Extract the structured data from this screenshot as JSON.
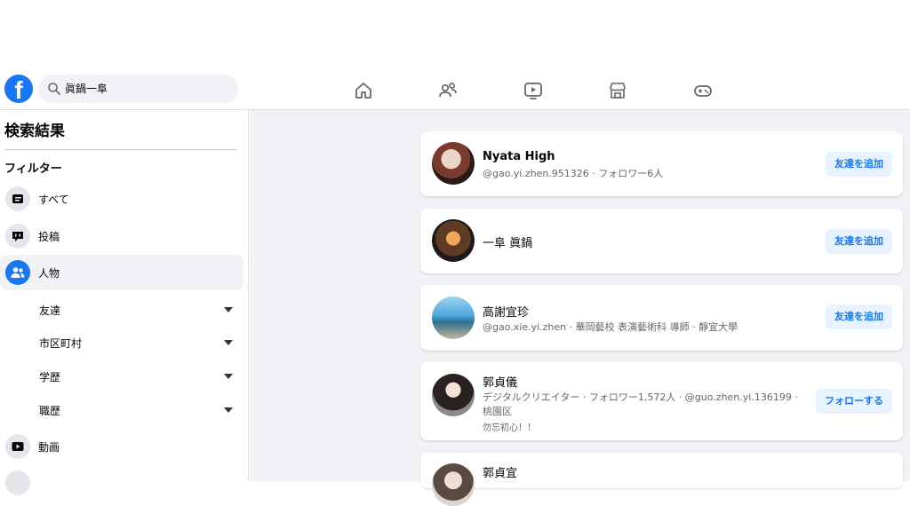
{
  "header": {
    "logo_letter": "f",
    "search_value": "眞鍋一阜",
    "nav_icons": [
      "home-icon",
      "friends-icon",
      "watch-icon",
      "marketplace-icon",
      "gaming-icon"
    ]
  },
  "sidebar": {
    "title": "検索結果",
    "filters_label": "フィルター",
    "items": [
      {
        "label": "すべて",
        "icon": "feed-icon"
      },
      {
        "label": "投稿",
        "icon": "post-icon"
      },
      {
        "label": "人物",
        "icon": "people-icon",
        "active": true
      }
    ],
    "subfilters": [
      {
        "label": "友達"
      },
      {
        "label": "市区町村"
      },
      {
        "label": "学歴"
      },
      {
        "label": "職歴"
      }
    ],
    "more_items": [
      {
        "label": "動画",
        "icon": "video-icon"
      }
    ]
  },
  "results": [
    {
      "name": "Nyata High",
      "line1": "@gao.yi.zhen.951326 · フォロワー6人",
      "button": "友達を追加"
    },
    {
      "name": "一阜 眞鍋",
      "button": "友達を追加"
    },
    {
      "name": "高謝宜珍",
      "line1": "@gao.xie.yi.zhen · 華岡藝校 表演藝術科 導師 · 靜宜大學",
      "button": "友達を追加"
    },
    {
      "name": "郭貞儀",
      "line1": "デジタルクリエイター · フォロワー1,572人 · @guo.zhen.yi.136199 ·",
      "line2": "桃園区",
      "line3": "勿忘初心！！",
      "button": "フォローする"
    },
    {
      "name": "郭貞宜"
    }
  ],
  "colors": {
    "accent": "#1877f2",
    "button_bg": "#e7f3ff",
    "page_bg": "#f0f2f5"
  }
}
